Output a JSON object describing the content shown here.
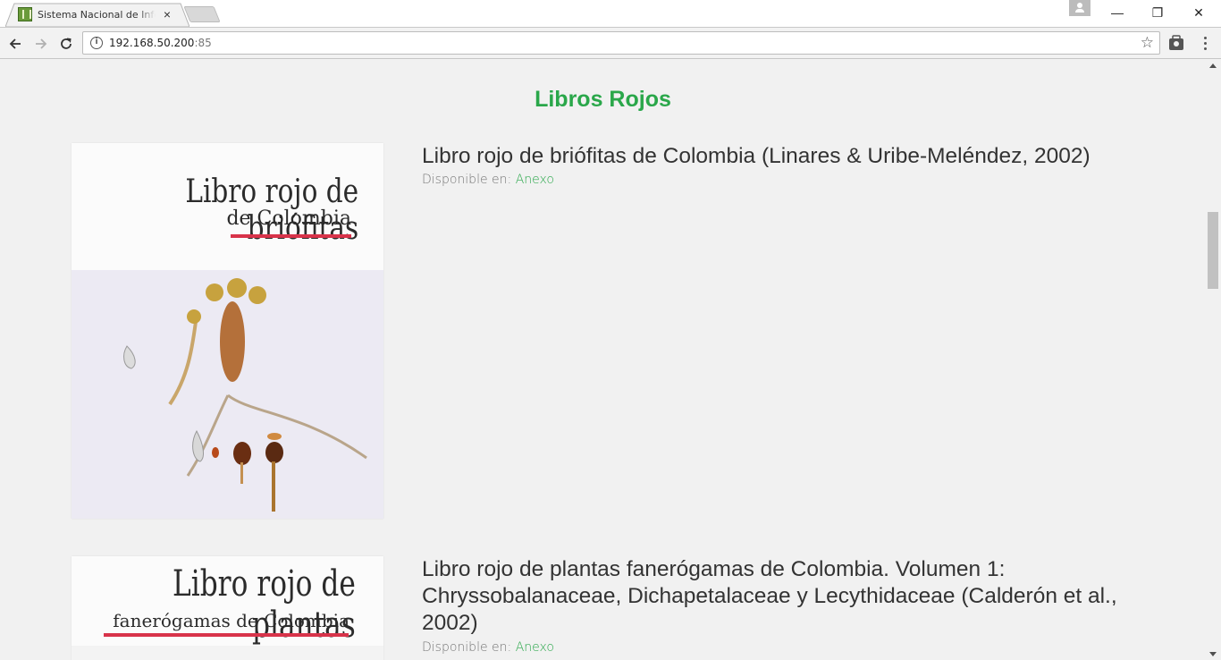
{
  "browser": {
    "tab_title": "Sistema Nacional de Información",
    "tab_close": "×",
    "url_host": "192.168.50.200",
    "url_port": ":85",
    "info_glyph": "i",
    "star_glyph": "☆",
    "back_glyph": "←",
    "forward_glyph": "→",
    "reload_glyph": "↻",
    "minimize_glyph": "—",
    "maximize_glyph": "❐",
    "close_glyph": "✕"
  },
  "page": {
    "title": "Libros Rojos",
    "accent_color": "#2aa74a"
  },
  "books": [
    {
      "title": "Libro rojo de briófitas de Colombia (Linares & Uribe-Meléndez, 2002)",
      "available_label": "Disponible en:",
      "link_label": "Anexo",
      "cover_line1": "Libro rojo de briófitas",
      "cover_line2": "de Colombia"
    },
    {
      "title": "Libro rojo de plantas fanerógamas de Colombia. Volumen 1: Chryssobalanaceae, Dichapetalaceae y Lecythidaceae (Calderón et al., 2002)",
      "available_label": "Disponible en:",
      "link_label": "Anexo",
      "cover_line1": "Libro rojo de plantas",
      "cover_line2": "fanerógamas de Colombia"
    }
  ]
}
